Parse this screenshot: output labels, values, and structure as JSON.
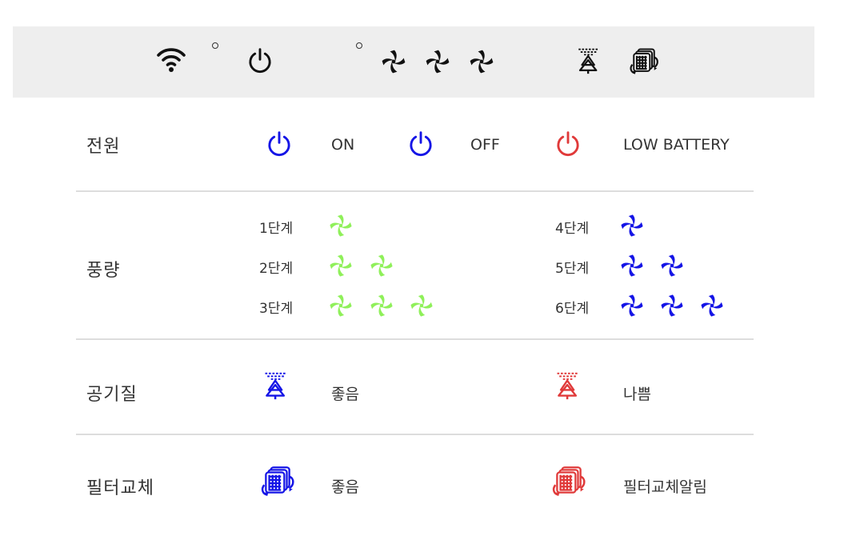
{
  "colors": {
    "blue": "#1515e6",
    "red": "#e03a3a",
    "green": "#8ff05a",
    "black": "#111111",
    "topbar_bg": "#eeeeee",
    "divider": "#dddddd"
  },
  "status_bar": {
    "icons": [
      "wifi-icon",
      "power-icon",
      "fan-icon",
      "fan-icon",
      "fan-icon",
      "air-quality-icon",
      "filter-icon"
    ]
  },
  "rows": {
    "power": {
      "label": "전원",
      "on": "ON",
      "off": "OFF",
      "low_battery": "LOW BATTERY"
    },
    "fan": {
      "label": "풍량",
      "levels": [
        "1단계",
        "2단계",
        "3단계",
        "4단계",
        "5단계",
        "6단계"
      ],
      "fan_counts": [
        1,
        2,
        3,
        1,
        2,
        3
      ]
    },
    "air_quality": {
      "label": "공기질",
      "good": "좋음",
      "bad": "나쁨"
    },
    "filter": {
      "label": "필터교체",
      "good": "좋음",
      "alert": "필터교체알림"
    }
  }
}
